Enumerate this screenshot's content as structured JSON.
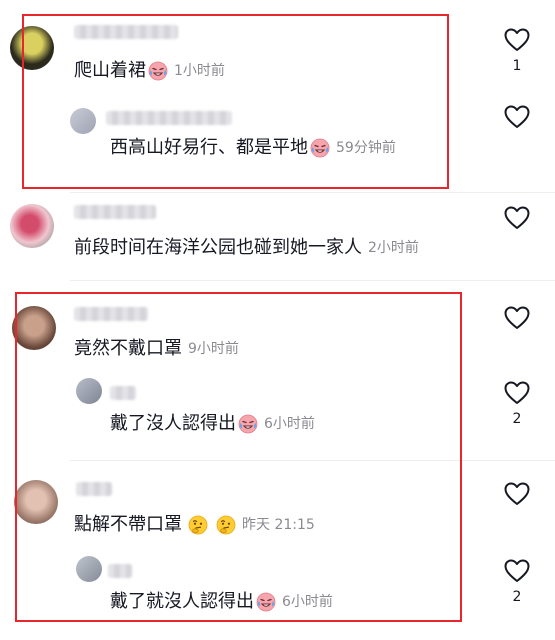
{
  "colors": {
    "highlight_box": "#e8262b",
    "meta_text": "#8a8b91",
    "text": "#161823"
  },
  "comments": [
    {
      "text": "爬山着裙",
      "emoji": [
        "crying-laughing-emoji"
      ],
      "time": "1小时前",
      "likes": "1",
      "replies": [
        {
          "text": "西高山好易行、都是平地",
          "emoji": [
            "crying-laughing-emoji"
          ],
          "time": "59分钟前"
        }
      ]
    },
    {
      "text": "前段时间在海洋公园也碰到她一家人",
      "emoji": [],
      "time": "2小时前",
      "likes": "",
      "replies": []
    },
    {
      "text": "竟然不戴口罩",
      "emoji": [],
      "time": "9小时前",
      "likes": "",
      "replies": [
        {
          "text": "戴了沒人認得出",
          "emoji": [
            "crying-laughing-emoji"
          ],
          "time": "6小时前",
          "likes": "2"
        }
      ]
    },
    {
      "text": "點解不帶口罩",
      "emoji": [
        "thinking-emoji",
        "thinking-emoji"
      ],
      "time": "昨天 21:15",
      "likes": "",
      "replies": [
        {
          "text": "戴了就沒人認得出",
          "emoji": [
            "crying-laughing-emoji"
          ],
          "time": "6小时前",
          "likes": "2"
        }
      ]
    }
  ]
}
